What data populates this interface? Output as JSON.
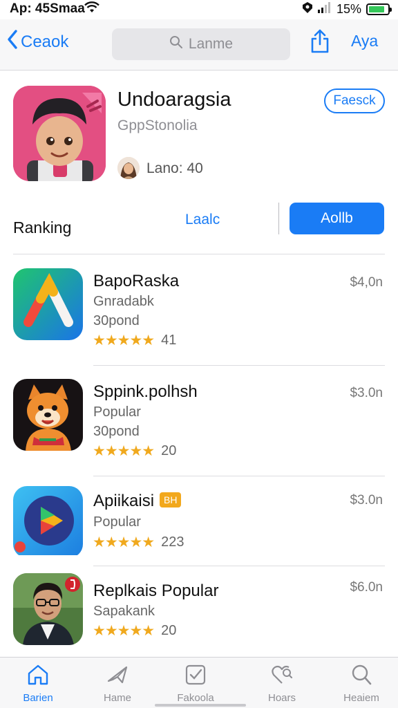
{
  "status": {
    "time": "Ap: 45Smaa",
    "battery": "15%",
    "battery_level": 0.85
  },
  "nav": {
    "back_label": "Ceaok",
    "search_text": "Lanme",
    "right_label": "Aya"
  },
  "featured": {
    "title": "Undoaragsia",
    "subtitle": "GppStonolia",
    "button": "Faesck",
    "user_text": "Lano: 40"
  },
  "ranking": {
    "title": "Ranking",
    "tab_left": "Laalc",
    "tab_right": "Aollb"
  },
  "apps": [
    {
      "name": "BapoRaska",
      "subtitle": "Gnradabk",
      "detail": "30pond",
      "price": "$4,0n",
      "rating": 5,
      "rating_count": "41",
      "badge": ""
    },
    {
      "name": "Sppink.polhsh",
      "subtitle": "Popular",
      "detail": "30pond",
      "price": "$3.0n",
      "rating": 4.5,
      "rating_count": "20",
      "badge": ""
    },
    {
      "name": "Apiikaisi",
      "subtitle": "Popular",
      "detail": "",
      "price": "$3.0n",
      "rating": 4.5,
      "rating_count": "223",
      "badge": "BH"
    },
    {
      "name": "Replkais Popular",
      "subtitle": "Sapakank",
      "detail": "",
      "price": "$6.0n",
      "rating": 5,
      "rating_count": "20",
      "badge": ""
    }
  ],
  "tabs": [
    {
      "label": "Barien",
      "icon": "home-icon",
      "active": true
    },
    {
      "label": "Hame",
      "icon": "plane-icon",
      "active": false
    },
    {
      "label": "Fakoola",
      "icon": "checkbox-icon",
      "active": false
    },
    {
      "label": "Hoars",
      "icon": "heart-search-icon",
      "active": false
    },
    {
      "label": "Heaiem",
      "icon": "search-icon",
      "active": false
    }
  ],
  "colors": {
    "accent": "#1a7cf5",
    "star": "#f0a91e",
    "badge": "#f2a81d"
  }
}
